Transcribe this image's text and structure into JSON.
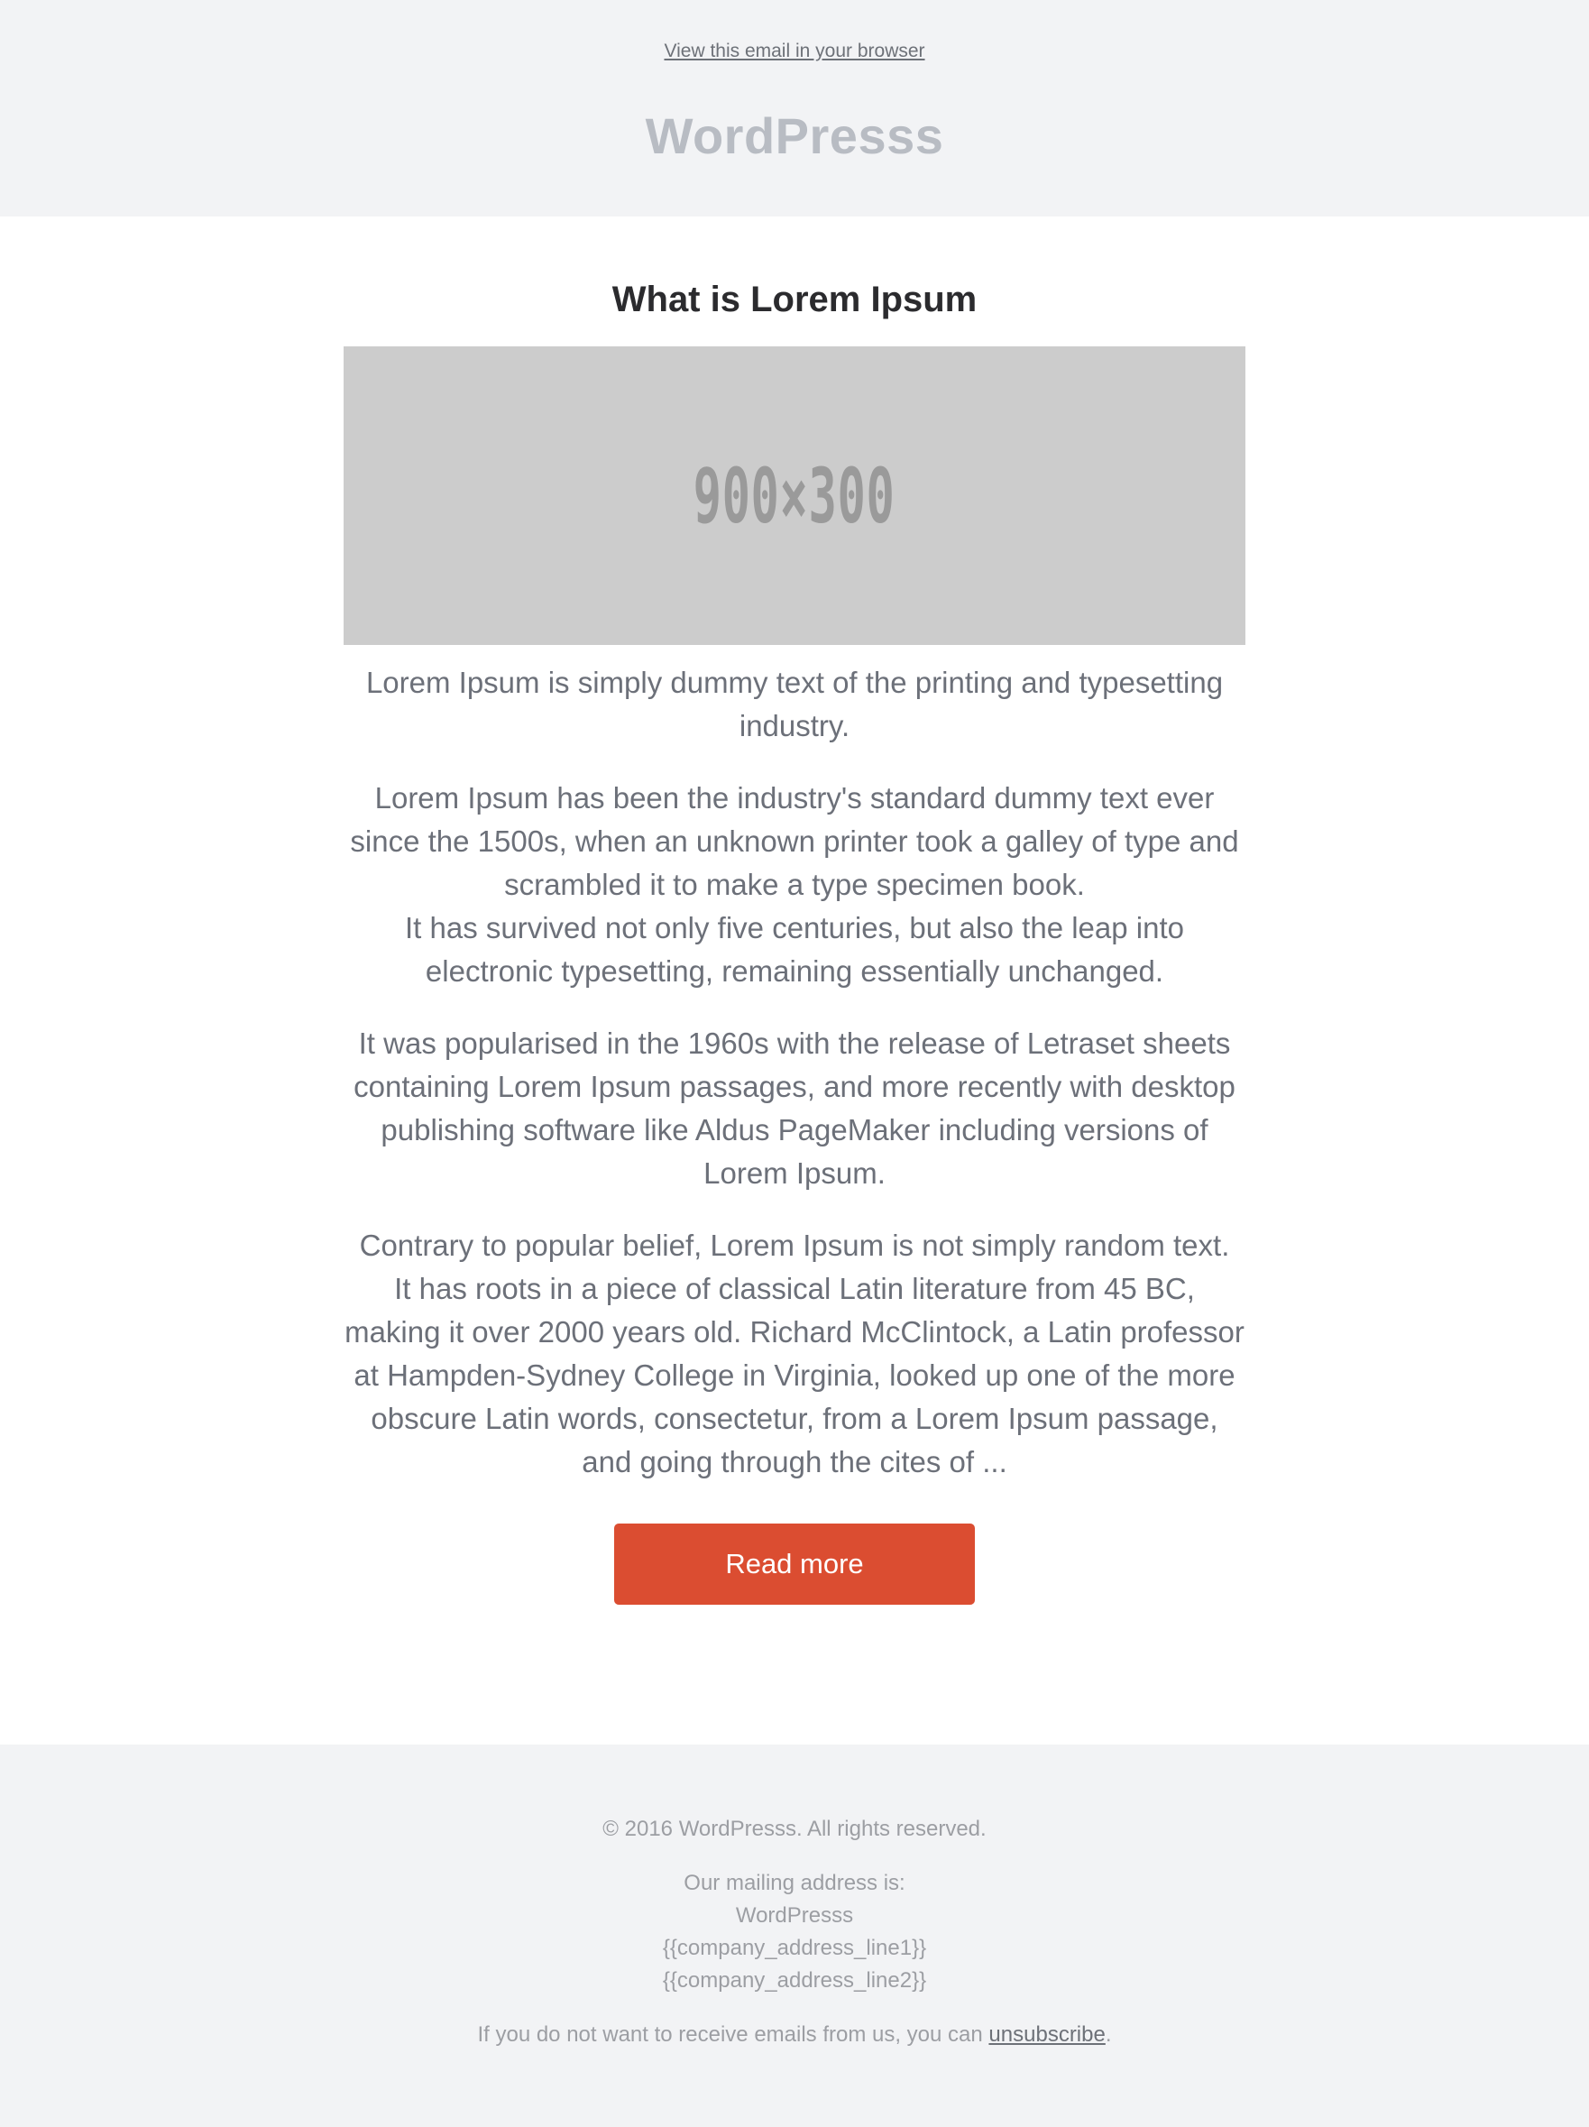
{
  "header": {
    "view_in_browser": "View this email in your browser",
    "brand": "WordPresss"
  },
  "article": {
    "title": "What is Lorem Ipsum",
    "image_label": "900×300",
    "paragraphs": [
      "Lorem Ipsum is simply dummy text of the printing and typesetting industry.",
      "Lorem Ipsum has been the industry's standard dummy text ever since the 1500s, when an unknown printer took a galley of type and scrambled it to make a type specimen book.",
      "It has survived not only five centuries, but also the leap into electronic typesetting, remaining essentially unchanged.",
      "It was popularised in the 1960s with the release of Letraset sheets containing Lorem Ipsum passages, and more recently with desktop publishing software like Aldus PageMaker including versions of Lorem Ipsum.",
      "Contrary to popular belief, Lorem Ipsum is not simply random text.",
      "It has roots in a piece of classical Latin literature from 45 BC, making it over 2000 years old. Richard McClintock, a Latin professor at Hampden-Sydney College in Virginia, looked up one of the more obscure Latin words, consectetur, from a Lorem Ipsum passage, and going through the cites of ..."
    ],
    "read_more": "Read more"
  },
  "footer": {
    "copyright": "© 2016 WordPresss. All rights reserved.",
    "mailing_label": "Our mailing address is:",
    "company": "WordPresss",
    "address_line1": "{{company_address_line1}}",
    "address_line2": "{{company_address_line2}}",
    "unsub_prefix": "If you do not want to receive emails from us, you can ",
    "unsub_link": "unsubscribe",
    "unsub_suffix": "."
  },
  "colors": {
    "button": "#db4d31",
    "background": "#f2f3f5",
    "title": "#2b2b2e",
    "text": "#6c7079"
  }
}
